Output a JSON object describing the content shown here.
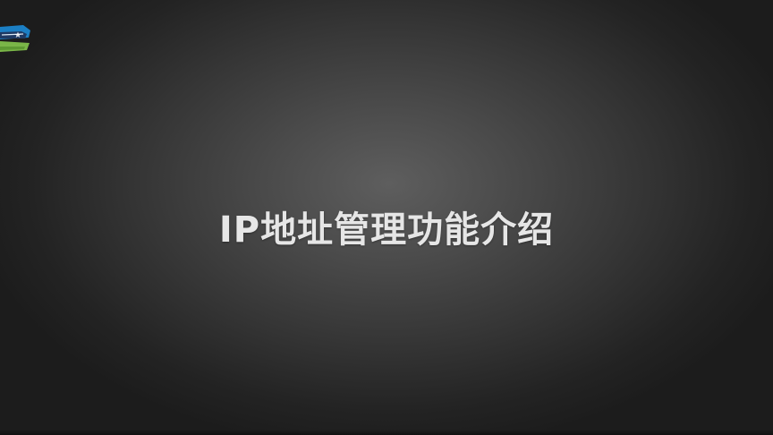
{
  "slide": {
    "title": "IP地址管理功能介绍",
    "background_color": "#4a4a4a",
    "title_color": "#e6e6e6"
  },
  "logo": {
    "icon": "brand-logo-icon",
    "colors": [
      "#1b7fc4",
      "#7ab648",
      "#1f3a63"
    ]
  }
}
